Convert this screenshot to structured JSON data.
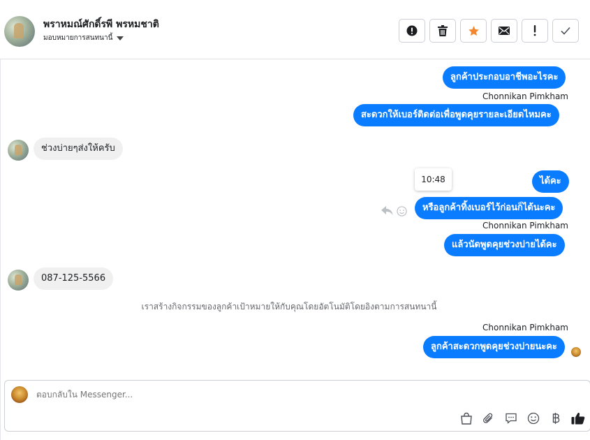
{
  "header": {
    "contact_name": "พราหมณ์ศักดิ์รพี พรหมชาติ",
    "assign_label": "มอบหมายการสนทนานี้",
    "actions": [
      {
        "name": "alert-circle-icon"
      },
      {
        "name": "trash-icon"
      },
      {
        "name": "star-icon"
      },
      {
        "name": "envelope-icon"
      },
      {
        "name": "exclamation-icon"
      },
      {
        "name": "check-icon"
      }
    ]
  },
  "messages": {
    "m1": "ลูกค้าประกอบอาชีพอะไรคะ",
    "sender1": "Chonnikan Pimkham",
    "m2": "สะดวกให้เบอร์ติดต่อเพื่อพูดคุยรายละเอียดไหมคะ",
    "m3": "ช่วงบ่ายๆส่งให้ครับ",
    "tooltip_time": "10:48",
    "m4": "ได้คะ",
    "m5": "หรือลูกค้าทิ้งเบอร์ไว้ก่อนก็ได้นะคะ",
    "sender2": "Chonnikan Pimkham",
    "m6": "แล้วนัดพูดคุยช่วงบ่ายได้คะ",
    "m7": "087-125-5566",
    "system_note": "เราสร้างกิจกรรมของลูกค้าเป้าหมายให้กับคุณโดยอัตโนมัติโดยอิงตามการสนทนานี้",
    "sender3": "Chonnikan Pimkham",
    "m8": "ลูกค้าสะดวกพูดคุยช่วงบ่ายนะคะ"
  },
  "composer": {
    "placeholder": "ตอบกลับใน Messenger..."
  },
  "colors": {
    "outgoing_bubble": "#0a7cff",
    "incoming_bubble": "#f0f0f0",
    "star": "#f5862a"
  }
}
